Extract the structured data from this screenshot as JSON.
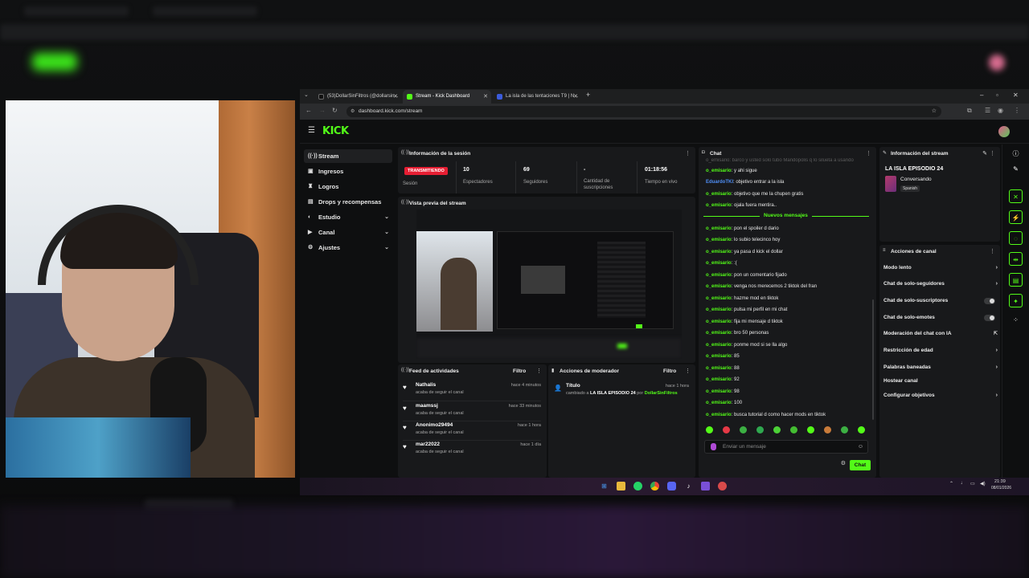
{
  "browser": {
    "tabs": [
      {
        "label": "(53)DollarSinFiltros (@dollarsin..."
      },
      {
        "label": "Stream - Kick Dashboard"
      },
      {
        "label": "La isla de las tentaciones T9 | N..."
      }
    ],
    "url": "dashboard.kick.com/stream"
  },
  "logo": "KICK",
  "sidebar": {
    "items": [
      {
        "label": "Stream"
      },
      {
        "label": "Ingresos"
      },
      {
        "label": "Logros"
      },
      {
        "label": "Drops y recompensas"
      },
      {
        "label": "Estudio"
      },
      {
        "label": "Canal"
      },
      {
        "label": "Ajustes"
      }
    ]
  },
  "session": {
    "title": "Información de la sesión",
    "live_badge": "TRANSMITIENDO",
    "session_label": "Sesión",
    "stats": [
      {
        "value": "10",
        "label": "Espectadores"
      },
      {
        "value": "69",
        "label": "Seguidores"
      },
      {
        "value": "-",
        "label": "Cantidad de suscripciones"
      },
      {
        "value": "01:18:56",
        "label": "Tiempo en vivo"
      }
    ]
  },
  "preview": {
    "title": "Vista previa del stream"
  },
  "activity": {
    "title": "Feed de actividades",
    "filter": "Filtro",
    "items": [
      {
        "name": "Nathalis",
        "sub": "acaba de seguir el canal",
        "time": "hace 4 minutos"
      },
      {
        "name": "maamssj",
        "sub": "acaba de seguir el canal",
        "time": "hace 33 minutos"
      },
      {
        "name": "Anonimo29494",
        "sub": "acaba de seguir el canal",
        "time": "hace 1 hora"
      },
      {
        "name": "mar22022",
        "sub": "acaba de seguir el canal",
        "time": "hace 1 día"
      }
    ]
  },
  "modactions": {
    "title": "Acciones de moderador",
    "filter": "Filtro",
    "item": {
      "name": "Título",
      "text_pre": "cambiado a ",
      "value": "LA ISLA EPISODIO 24",
      "text_mid": " por ",
      "user": "DollarSinFiltros",
      "time": "hace 1 hora"
    }
  },
  "chat": {
    "title": "Chat",
    "top_partial": "o_emisario: barco y usted solo tubo Mandopolis q lo silueta a usando",
    "lines_before": [
      {
        "user": "o_emisario",
        "text": ": y ahi sigue"
      },
      {
        "user": "EduardoTKI",
        "text": ": objetivo entrar a la isla",
        "alt": true
      },
      {
        "user": "o_emisario",
        "text": ": objetivo que me la chupen gratis"
      },
      {
        "user": "o_emisario",
        "text": ": ojala fuera mentira.."
      }
    ],
    "new_messages": "Nuevos mensajes",
    "lines_after": [
      {
        "user": "o_emisario",
        "text": ": pon el spoiler d dario"
      },
      {
        "user": "o_emisario",
        "text": ": lo subio telecinco hoy"
      },
      {
        "user": "o_emisario",
        "text": ": ya pasa d kick el dollar"
      },
      {
        "user": "o_emisario",
        "text": ": :("
      },
      {
        "user": "o_emisario",
        "text": ": pon un comentario fijado"
      },
      {
        "user": "o_emisario",
        "text": ": venga nos merecemos 2 tiktok del fran"
      },
      {
        "user": "o_emisario",
        "text": ": hazme mod en tiktok"
      },
      {
        "user": "o_emisario",
        "text": ": pulsa mi perfil en mi chat"
      },
      {
        "user": "o_emisario",
        "text": ": fija mi mensaje d tiktok"
      },
      {
        "user": "o_emisario",
        "text": ": bro 50 personas"
      },
      {
        "user": "o_emisario",
        "text": ": ponme mod si se lla algo"
      },
      {
        "user": "o_emisario",
        "text": ": 85"
      },
      {
        "user": "o_emisario",
        "text": ": 88"
      },
      {
        "user": "o_emisario",
        "text": ": 92"
      },
      {
        "user": "o_emisario",
        "text": ": 98"
      },
      {
        "user": "o_emisario",
        "text": ": 100"
      },
      {
        "user": "o_emisario",
        "text": ": busca tutorial d como hacer mods en tiktok"
      }
    ],
    "input_placeholder": "Enviar un mensaje",
    "send_label": "Chat"
  },
  "streaminfo": {
    "title": "Información del stream",
    "stream_title": "LA ISLA EPISODIO 24",
    "category": "Conversando",
    "language": "Spanish"
  },
  "channel_actions": {
    "title": "Acciones de canal",
    "items": [
      {
        "label": "Modo lento",
        "control": "arrow"
      },
      {
        "label": "Chat de solo-seguidores",
        "control": "arrow"
      },
      {
        "label": "Chat de solo-suscriptores",
        "control": "toggle"
      },
      {
        "label": "Chat de solo-emotes",
        "control": "toggle"
      },
      {
        "label": "Moderación del chat con IA",
        "control": "external"
      },
      {
        "label": "Restricción de edad",
        "control": "arrow"
      },
      {
        "label": "Palabras baneadas",
        "control": "arrow"
      },
      {
        "label": "Hostear canal",
        "control": "none"
      },
      {
        "label": "Configurar objetivos",
        "control": "arrow"
      }
    ]
  },
  "taskbar": {
    "time": "21:39",
    "date": "08/01/2026"
  },
  "colors": {
    "kick_green": "#53fc18",
    "live_red": "#e61e33"
  }
}
